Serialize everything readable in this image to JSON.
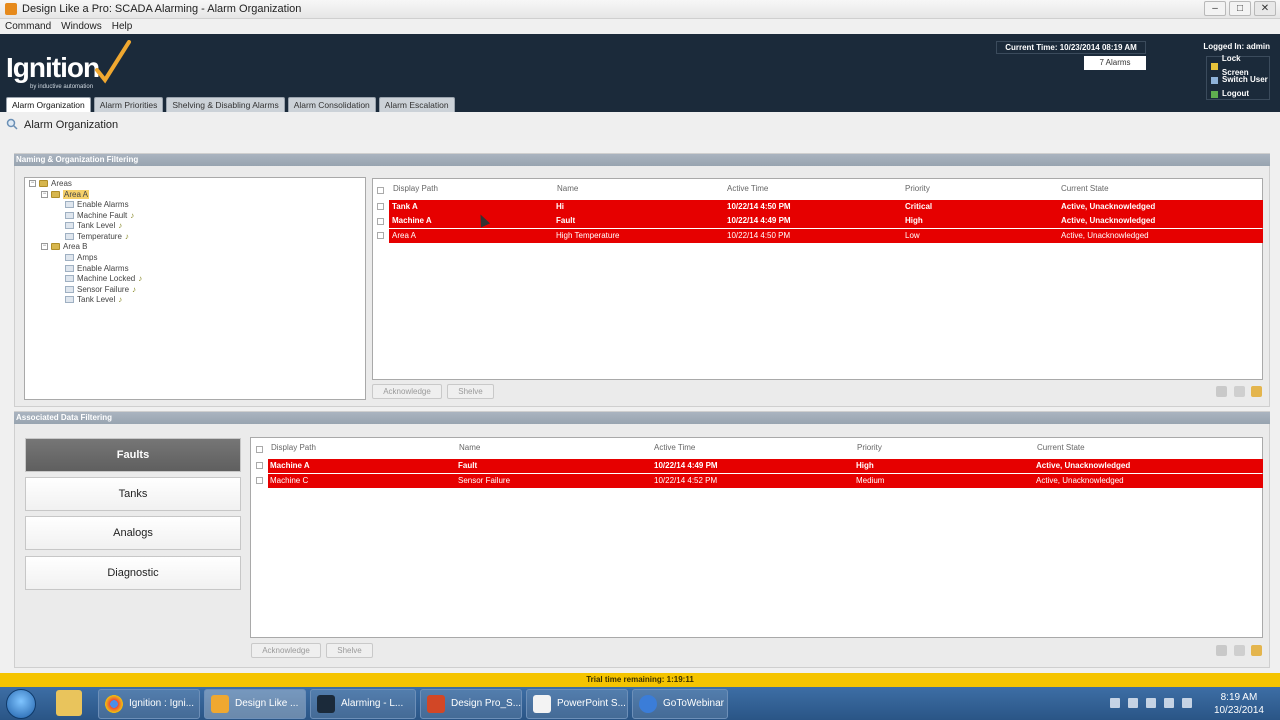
{
  "window": {
    "title": "Design Like a Pro: SCADA Alarming - Alarm Organization",
    "controls": [
      "–",
      "□",
      "✕"
    ]
  },
  "menu": [
    "Command",
    "Windows",
    "Help"
  ],
  "header": {
    "logo": "Ignition",
    "logo_sub": "by inductive automation",
    "current_time": "Current Time: 10/23/2014 08:19 AM",
    "alarm_count": "7 Alarms",
    "logged_in": "Logged In: admin",
    "user_links": [
      "Lock Screen",
      "Switch User",
      "Logout"
    ]
  },
  "tabs": [
    {
      "label": "Alarm Organization",
      "active": true
    },
    {
      "label": "Alarm Priorities",
      "active": false
    },
    {
      "label": "Shelving & Disabling Alarms",
      "active": false
    },
    {
      "label": "Alarm Consolidation",
      "active": false
    },
    {
      "label": "Alarm Escalation",
      "active": false
    }
  ],
  "page_title": "Alarm Organization",
  "section1": {
    "title": "Naming & Organization Filtering",
    "tree": {
      "root": "Areas",
      "area_a": "Area A",
      "area_a_items": [
        "Enable Alarms",
        "Machine Fault",
        "Tank Level",
        "Temperature"
      ],
      "area_b": "Area B",
      "area_b_items": [
        "Amps",
        "Enable Alarms",
        "Machine Locked",
        "Sensor Failure",
        "Tank Level"
      ]
    },
    "columns": [
      "Display Path",
      "Name",
      "Active Time",
      "Priority",
      "Current State"
    ],
    "rows": [
      [
        "Tank A",
        "Hi",
        "10/22/14 4:50 PM",
        "Critical",
        "Active, Unacknowledged"
      ],
      [
        "Machine A",
        "Fault",
        "10/22/14 4:49 PM",
        "High",
        "Active, Unacknowledged"
      ],
      [
        "Area A",
        "High Temperature",
        "10/22/14 4:50 PM",
        "Low",
        "Active, Unacknowledged"
      ]
    ],
    "acknowledge": "Acknowledge",
    "shelve": "Shelve"
  },
  "section2": {
    "title": "Associated Data Filtering",
    "filters": [
      "Faults",
      "Tanks",
      "Analogs",
      "Diagnostic"
    ],
    "columns": [
      "Display Path",
      "Name",
      "Active Time",
      "Priority",
      "Current State"
    ],
    "rows": [
      [
        "Machine A",
        "Fault",
        "10/22/14 4:49 PM",
        "High",
        "Active, Unacknowledged"
      ],
      [
        "Machine C",
        "Sensor Failure",
        "10/22/14 4:52 PM",
        "Medium",
        "Active, Unacknowledged"
      ]
    ],
    "acknowledge": "Acknowledge",
    "shelve": "Shelve"
  },
  "trial": "Trial time remaining: 1:19:11",
  "taskbar": {
    "items": [
      "Ignition : Igni...",
      "Design Like ...",
      "Alarming - L...",
      "Design Pro_S...",
      "PowerPoint S...",
      "GoToWebinar"
    ],
    "time": "8:19 AM",
    "date": "10/23/2014"
  },
  "colors": {
    "alarm_red": "#e60000",
    "header_navy": "#1b2a3a",
    "trial_yellow": "#f5c400"
  }
}
